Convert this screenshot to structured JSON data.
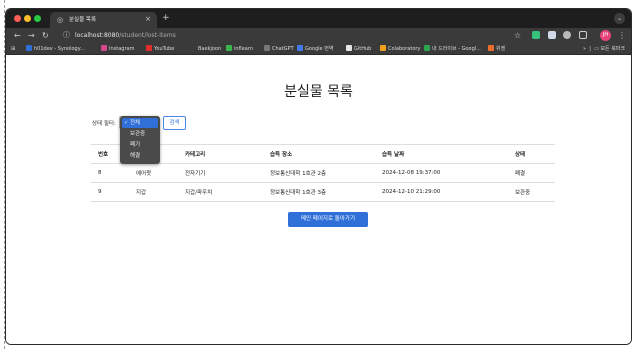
{
  "browser": {
    "tab_title": "분실물 목록",
    "url_host": "localhost:8080",
    "url_path": "/student/lost-items",
    "profile_initial": "JH",
    "bookmarks": [
      {
        "label": "h01dev - Synology...",
        "color": "#2f6fd8"
      },
      {
        "label": "Instagram",
        "color": "#d9468e"
      },
      {
        "label": "YouTube",
        "color": "#e52d27"
      },
      {
        "label": "Baekjoon",
        "color": "#3a3a3a"
      },
      {
        "label": "inflearn",
        "color": "#39b54a"
      },
      {
        "label": "ChatGPT",
        "color": "#777777"
      },
      {
        "label": "Google 번역",
        "color": "#3f7be8"
      },
      {
        "label": "GitHub",
        "color": "#e6e6e6"
      },
      {
        "label": "Colaboratory",
        "color": "#f3a11d"
      },
      {
        "label": "내 드라이브 - Googl...",
        "color": "#2da44e"
      },
      {
        "label": "위젠",
        "color": "#e8702a"
      }
    ],
    "all_bookmarks_label": "모든 북마크"
  },
  "page": {
    "title": "분실물 목록",
    "filter_label": "상태 필터:",
    "search_button": "검색",
    "main_button": "메인 페이지로 돌아가기"
  },
  "dropdown": {
    "options": [
      "전체",
      "보관중",
      "폐기",
      "해결"
    ],
    "selected": "전체"
  },
  "table": {
    "headers": [
      "번호",
      "분실물명",
      "카테고리",
      "습득 장소",
      "습득 날짜",
      "상태"
    ],
    "rows": [
      [
        "8",
        "에어팟",
        "전자기기",
        "정보통신대학 1호관 2층",
        "2024-12-08 19:37:00",
        "폐결"
      ],
      [
        "9",
        "지갑",
        "지갑/파우치",
        "정보통신대학 1호관 3층",
        "2024-12-10 21:29:00",
        "보관중"
      ]
    ]
  }
}
